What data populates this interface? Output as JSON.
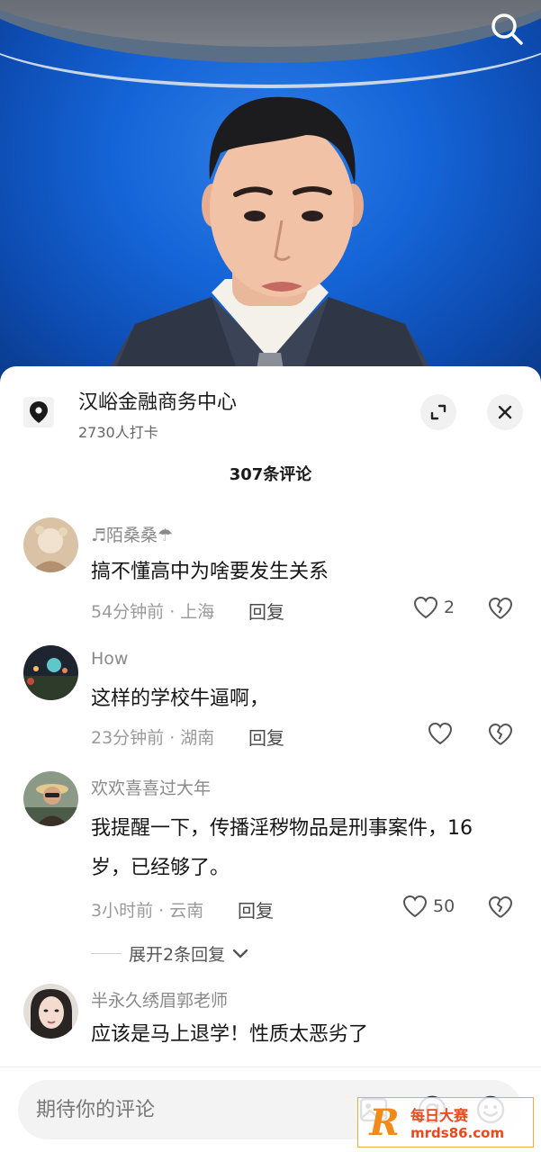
{
  "location": {
    "name": "汉峪金融商务中心",
    "checkins": "2730人打卡"
  },
  "comments_count": "307条评论",
  "comments": [
    {
      "user": "♬陌桑桑☂",
      "text": "搞不懂高中为啥要发生关系",
      "meta": "54分钟前 · 上海",
      "reply": "回复",
      "likes": "2"
    },
    {
      "user": "How",
      "text": "这样的学校牛逼啊，",
      "meta": "23分钟前 · 湖南",
      "reply": "回复",
      "likes": ""
    },
    {
      "user": "欢欢喜喜过大年",
      "text": "我提醒一下，传播淫秽物品是刑事案件，16岁，已经够了。",
      "meta": "3小时前 · 云南",
      "reply": "回复",
      "likes": "50",
      "expand": "展开2条回复"
    },
    {
      "user": "半永久绣眉郭老师",
      "text": "应该是马上退学！性质太恶劣了",
      "meta": "",
      "reply": "",
      "likes": ""
    }
  ],
  "input": {
    "placeholder": "期待你的评论"
  },
  "watermark": {
    "line1": "每日大赛",
    "line2": "mrds86.com"
  },
  "colors": {
    "video_bg": "#1565d8",
    "accent_orange": "#f28a1a",
    "watermark_red": "#e8491d"
  }
}
